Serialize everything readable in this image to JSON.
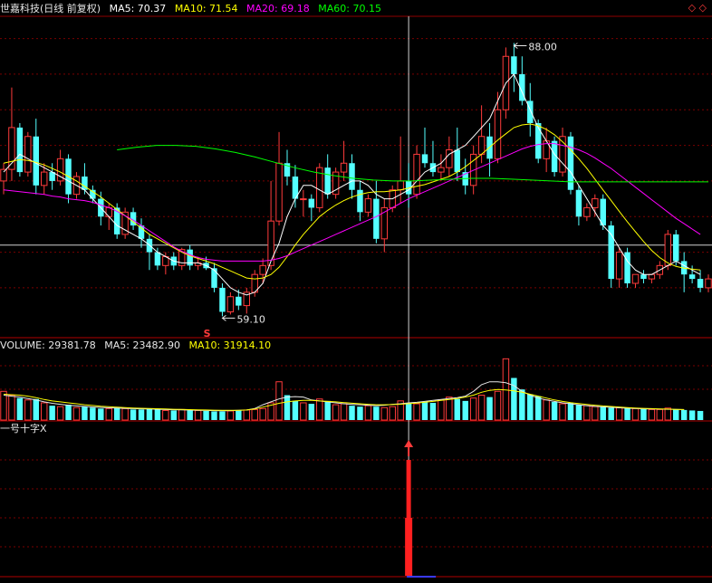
{
  "header": {
    "stock_name": "世嘉科技(日线 前复权)",
    "ma5": "MA5: 70.37",
    "ma10": "MA10: 71.54",
    "ma20": "MA20: 69.18",
    "ma60": "MA60: 70.15",
    "corner_icons": "◇ ◇"
  },
  "volume_header": {
    "volume": "VOLUME: 29381.78",
    "ma5": "MA5: 23482.90",
    "ma10": "MA10: 31914.10"
  },
  "indicator_header": {
    "title": "一号十字X"
  },
  "annotations": {
    "high_label": "88.00",
    "low_label": "59.10",
    "signal_mark": "S"
  },
  "colors": {
    "up": "#ff3b3b",
    "down": "#54ffff",
    "ma5": "#ffffff",
    "ma10": "#ffff00",
    "ma20": "#ff00ff",
    "ma60": "#00ff00",
    "grid": "#7a0000",
    "crosshair": "#cfcfcf"
  },
  "chart_data": [
    {
      "type": "candlestick",
      "price_range": [
        56.5,
        92.5
      ],
      "series_colors": {
        "MA5": "#ffffff",
        "MA10": "#ffff00",
        "MA20": "#ff00ff",
        "MA60": "#00ff00"
      },
      "candles": [
        [
          74,
          76,
          72.5,
          75.3
        ],
        [
          75.3,
          84.5,
          74,
          80
        ],
        [
          80,
          80.5,
          74.5,
          75
        ],
        [
          75,
          79.5,
          74.5,
          79
        ],
        [
          79,
          81,
          72.5,
          73.5
        ],
        [
          73.5,
          76,
          72.5,
          75
        ],
        [
          75,
          76,
          73,
          74
        ],
        [
          74,
          77.5,
          73.5,
          76.5
        ],
        [
          76.5,
          77,
          71.5,
          72.5
        ],
        [
          72.5,
          75,
          72,
          74.5
        ],
        [
          74.5,
          76,
          72.5,
          73
        ],
        [
          73,
          73.5,
          71.5,
          72
        ],
        [
          72,
          72.8,
          69,
          70
        ],
        [
          70,
          71.5,
          68.5,
          71
        ],
        [
          71,
          71.5,
          67.5,
          68
        ],
        [
          68,
          71,
          67.5,
          70.5
        ],
        [
          70.5,
          71,
          68.5,
          69
        ],
        [
          69,
          69.8,
          66.5,
          67.5
        ],
        [
          67.5,
          68,
          64,
          66
        ],
        [
          66,
          66.5,
          64,
          64.5
        ],
        [
          64.5,
          66,
          63.5,
          65.5
        ],
        [
          65.5,
          66,
          64,
          64.5
        ],
        [
          64.5,
          66.5,
          64,
          66.3
        ],
        [
          66.3,
          66.8,
          64,
          64.5
        ],
        [
          64.5,
          65.5,
          64,
          64.8
        ],
        [
          64.8,
          65.5,
          64,
          64.2
        ],
        [
          64.2,
          64.8,
          61.5,
          62
        ],
        [
          62,
          62.5,
          58.8,
          59.3
        ],
        [
          59.3,
          61.5,
          59,
          61
        ],
        [
          61,
          61.8,
          59.5,
          60
        ],
        [
          60,
          62,
          59.1,
          61.5
        ],
        [
          61.5,
          64,
          61,
          63.5
        ],
        [
          63.5,
          65.3,
          62.5,
          64.5
        ],
        [
          64.5,
          74,
          64,
          69.5
        ],
        [
          69.5,
          79.5,
          69,
          76
        ],
        [
          76,
          77.5,
          73.5,
          74.5
        ],
        [
          74.5,
          75.8,
          71,
          72
        ],
        [
          72,
          73,
          70,
          72
        ],
        [
          72,
          72.5,
          69.5,
          71
        ],
        [
          71,
          76,
          70.5,
          75.5
        ],
        [
          75.5,
          77,
          72,
          72.5
        ],
        [
          72.5,
          75.5,
          72,
          75
        ],
        [
          75,
          78.5,
          74,
          76
        ],
        [
          76,
          77,
          72,
          73
        ],
        [
          73,
          74,
          69.5,
          70.5
        ],
        [
          70.5,
          72.5,
          70,
          72
        ],
        [
          72,
          74,
          67,
          67.5
        ],
        [
          67.5,
          72,
          66,
          71
        ],
        [
          71,
          73.5,
          70.5,
          73
        ],
        [
          73,
          79,
          71.5,
          74
        ],
        [
          74,
          76,
          71,
          72.5
        ],
        [
          72.5,
          78,
          72,
          77
        ],
        [
          77,
          80,
          75.5,
          76
        ],
        [
          76,
          78.5,
          74.5,
          75
        ],
        [
          75,
          77,
          74,
          75.5
        ],
        [
          75.5,
          79,
          74.5,
          77.5
        ],
        [
          77.5,
          80,
          74,
          75
        ],
        [
          75,
          76.5,
          72.5,
          73.5
        ],
        [
          73.5,
          78,
          72.5,
          77
        ],
        [
          77,
          82.5,
          76,
          79
        ],
        [
          79,
          80.5,
          74.5,
          76.5
        ],
        [
          76.5,
          84,
          76,
          82
        ],
        [
          82,
          89,
          81,
          88
        ],
        [
          88,
          89.5,
          84,
          86
        ],
        [
          86,
          88,
          82.5,
          83
        ],
        [
          83,
          85,
          79,
          80.5
        ],
        [
          80.5,
          80.9,
          76,
          76.5
        ],
        [
          76.5,
          80,
          75,
          78.5
        ],
        [
          78.5,
          79,
          74.5,
          75
        ],
        [
          75,
          80,
          74.5,
          79
        ],
        [
          79,
          79.5,
          72.5,
          73
        ],
        [
          73,
          73.5,
          69,
          70
        ],
        [
          70,
          71.5,
          69.5,
          71
        ],
        [
          71,
          72.5,
          70,
          72
        ],
        [
          72,
          72.5,
          68.5,
          69
        ],
        [
          69,
          69.5,
          62,
          63
        ],
        [
          63,
          66.5,
          62,
          66
        ],
        [
          66,
          66.5,
          62,
          62.5
        ],
        [
          62.5,
          63.5,
          62,
          63.5
        ],
        [
          63.5,
          64,
          62.5,
          63
        ],
        [
          63,
          63.5,
          62.5,
          63.5
        ],
        [
          63.5,
          65,
          63,
          64.5
        ],
        [
          64.5,
          68.5,
          64,
          68
        ],
        [
          68,
          68.5,
          64.5,
          65
        ],
        [
          65,
          66,
          61.5,
          63.5
        ],
        [
          63.5,
          64.5,
          62.5,
          63
        ],
        [
          63,
          64,
          61.5,
          62
        ],
        [
          62,
          63.5,
          61.5,
          63
        ]
      ],
      "ma5": [
        75,
        76,
        77,
        76.5,
        76,
        75.5,
        75,
        74.5,
        74,
        73.5,
        73,
        72,
        71,
        70,
        69,
        68.5,
        68,
        67.5,
        66.8,
        66,
        65.5,
        65,
        64.8,
        64.8,
        64.8,
        64.5,
        64,
        63,
        62,
        61.5,
        61.2,
        61.5,
        62.5,
        65,
        67,
        70,
        72,
        73.5,
        73.5,
        73,
        72.5,
        73,
        73.5,
        74,
        74,
        73.5,
        72.5,
        72,
        72,
        72.5,
        73,
        74,
        75,
        75.5,
        76,
        77,
        77.5,
        78,
        79,
        80,
        81,
        83,
        85,
        86,
        84,
        82,
        80,
        78.5,
        77,
        76,
        75,
        73.5,
        72,
        70.5,
        69,
        68,
        66.5,
        65,
        64,
        63.5,
        63.5,
        64,
        64.5,
        65,
        64.5,
        64,
        63.5
      ],
      "ma10": [
        76,
        76.2,
        76.4,
        76.3,
        76.1,
        75.8,
        75.4,
        75,
        74.5,
        74,
        73.4,
        72.8,
        72.2,
        71.5,
        70.8,
        70.1,
        69.4,
        68.7,
        68,
        67.5,
        67,
        66.5,
        66,
        65.6,
        65.3,
        65,
        64.7,
        64.3,
        63.9,
        63.5,
        63.1,
        63,
        63.1,
        63.5,
        64.3,
        65.5,
        66.8,
        68,
        69,
        70,
        70.7,
        71.3,
        71.8,
        72.2,
        72.5,
        72.7,
        72.8,
        72.8,
        72.9,
        73,
        73.2,
        73.4,
        73.6,
        73.9,
        74.2,
        74.5,
        75,
        75.6,
        76.3,
        77,
        77.8,
        78.6,
        79.3,
        80,
        80.3,
        80.4,
        80.2,
        79.8,
        79.2,
        78.4,
        77.5,
        76.5,
        75.4,
        74.2,
        73,
        71.8,
        70.6,
        69.4,
        68.3,
        67.2,
        66.2,
        65.4,
        64.8,
        64.4,
        64.2,
        64.1,
        64
      ],
      "ma20": [
        73,
        72.9,
        72.8,
        72.7,
        72.6,
        72.5,
        72.3,
        72.2,
        72,
        71.9,
        71.8,
        71.6,
        71.3,
        71,
        70.6,
        70.1,
        69.6,
        69,
        68.4,
        67.8,
        67.2,
        66.6,
        66.1,
        65.7,
        65.4,
        65.2,
        65.1,
        65,
        65,
        65,
        65,
        65,
        65,
        65.1,
        65.3,
        65.6,
        66,
        66.4,
        66.8,
        67.2,
        67.6,
        68,
        68.4,
        68.8,
        69.2,
        69.6,
        70,
        70.5,
        71,
        71.5,
        72,
        72.4,
        72.8,
        73.2,
        73.6,
        74,
        74.4,
        74.8,
        75.2,
        75.6,
        76,
        76.4,
        76.8,
        77.2,
        77.6,
        77.9,
        78.1,
        78.2,
        78.2,
        78,
        77.8,
        77.5,
        77.1,
        76.6,
        76,
        75.4,
        74.7,
        74,
        73.3,
        72.6,
        71.9,
        71.2,
        70.5,
        69.8,
        69.2,
        68.6,
        68
      ],
      "ma60": [
        null,
        null,
        null,
        null,
        null,
        null,
        null,
        null,
        null,
        null,
        null,
        null,
        null,
        null,
        null,
        null,
        null,
        null,
        null,
        null,
        null,
        null,
        null,
        null,
        null,
        null,
        null,
        null,
        null,
        null,
        null,
        null,
        null,
        null,
        null,
        null,
        null,
        null,
        null,
        null,
        null,
        null,
        null,
        null,
        null,
        null,
        null,
        null,
        null,
        null,
        null,
        null,
        null,
        null,
        null,
        null,
        null,
        null,
        null,
        null,
        null,
        null,
        null,
        null,
        null,
        null,
        null,
        null,
        null,
        null,
        null,
        null,
        null,
        null,
        null,
        null,
        null,
        null,
        null,
        null,
        null,
        null,
        null,
        null,
        null,
        null,
        null
      ],
      "ma60_curve": [
        77.5,
        77.8,
        78,
        78,
        77.9,
        77.6,
        77.2,
        76.7,
        76.1,
        75.5,
        75,
        74.6,
        74.3,
        74.1,
        74,
        74,
        74.1,
        74.2,
        74.3,
        74.3,
        74.2,
        74.1,
        74,
        73.9,
        73.9,
        73.9,
        73.9,
        73.9,
        73.9,
        73.9,
        73.9
      ],
      "annotations": [
        "88.00",
        "59.10",
        "S"
      ]
    },
    {
      "type": "bar",
      "title": "VOLUME",
      "ylim": [
        0,
        70000
      ],
      "values": [
        30000,
        26000,
        23000,
        21000,
        22000,
        18000,
        15000,
        14000,
        16000,
        13000,
        14000,
        13000,
        12000,
        12000,
        13000,
        12000,
        11000,
        11000,
        12000,
        11000,
        10000,
        10000,
        11000,
        10000,
        10000,
        9500,
        9000,
        9000,
        9500,
        10000,
        10500,
        11000,
        12000,
        18000,
        40000,
        26000,
        20000,
        18000,
        17000,
        22000,
        20000,
        16000,
        17000,
        15000,
        14000,
        15000,
        14000,
        13000,
        14000,
        20000,
        18000,
        17000,
        19000,
        18000,
        21000,
        24000,
        22000,
        20000,
        23000,
        26000,
        24000,
        30000,
        64000,
        44000,
        32000,
        27000,
        25000,
        21000,
        19000,
        17000,
        18000,
        16000,
        15000,
        14000,
        14000,
        13000,
        13000,
        12500,
        12000,
        11500,
        11000,
        11000,
        12500,
        11000,
        10500,
        10000,
        9500
      ],
      "ma5": [
        26000,
        25000,
        24000,
        22500,
        21000,
        19000,
        17500,
        16500,
        15500,
        14800,
        14200,
        13600,
        13200,
        12800,
        12500,
        12200,
        11900,
        11700,
        11500,
        11300,
        11000,
        10800,
        10600,
        10400,
        10200,
        10000,
        9800,
        9700,
        9800,
        10100,
        10500,
        12000,
        16000,
        19000,
        22000,
        24000,
        24500,
        24000,
        21000,
        20000,
        19000,
        18000,
        17000,
        16500,
        16000,
        15500,
        15000,
        15500,
        16500,
        17000,
        18000,
        18500,
        19500,
        20500,
        21500,
        22500,
        23500,
        25000,
        30000,
        37000,
        40000,
        40000,
        39000,
        36000,
        30000,
        26000,
        23000,
        21000,
        19500,
        18000,
        17000,
        16000,
        15000,
        14300,
        13800,
        13300,
        12800,
        12400,
        12000,
        11700,
        11500,
        11400,
        11300,
        11100,
        10900
      ],
      "ma10": [
        27000,
        26500,
        26000,
        25000,
        23500,
        21500,
        20000,
        19000,
        18000,
        17000,
        16000,
        15200,
        14500,
        13900,
        13400,
        13000,
        12600,
        12300,
        12000,
        11800,
        11500,
        11300,
        11100,
        10900,
        10700,
        10500,
        10300,
        10200,
        10100,
        10200,
        10500,
        11500,
        13500,
        15500,
        17500,
        19000,
        20000,
        20500,
        20500,
        20000,
        19500,
        19000,
        18300,
        17600,
        17000,
        16500,
        16000,
        16000,
        16200,
        16600,
        17100,
        17800,
        18600,
        19500,
        20500,
        21500,
        22500,
        24000,
        26000,
        29000,
        31000,
        32000,
        31500,
        30500,
        29000,
        27000,
        25000,
        23000,
        21000,
        19500,
        18200,
        17200,
        16300,
        15500,
        14800,
        14200,
        13600,
        13100,
        12600,
        12200,
        11900,
        11600,
        11400,
        11200,
        11000
      ]
    },
    {
      "type": "bar",
      "title": "一号十字X",
      "signal_index": 50,
      "values_note": "single signal spike"
    }
  ]
}
